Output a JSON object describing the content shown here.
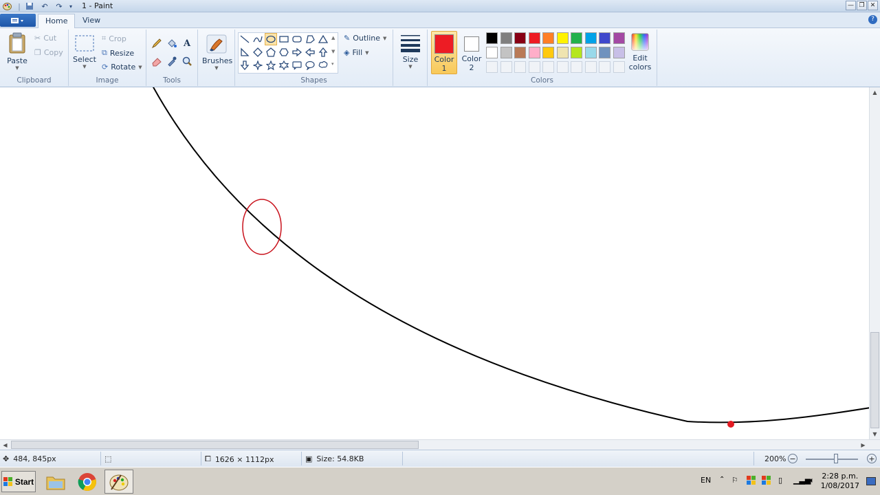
{
  "window": {
    "title": "1 - Paint",
    "controls": [
      "minimize",
      "restore",
      "close"
    ]
  },
  "tabs": [
    {
      "label": "Home",
      "active": true
    },
    {
      "label": "View",
      "active": false
    }
  ],
  "ribbon": {
    "clipboard": {
      "label": "Clipboard",
      "paste": "Paste",
      "cut": "Cut",
      "copy": "Copy"
    },
    "image": {
      "label": "Image",
      "select": "Select",
      "crop": "Crop",
      "resize": "Resize",
      "rotate": "Rotate"
    },
    "tools": {
      "label": "Tools"
    },
    "brushes": {
      "label": "Brushes"
    },
    "shapes": {
      "label": "Shapes",
      "outline": "Outline",
      "fill": "Fill"
    },
    "size": {
      "label": "Size"
    },
    "colors": {
      "label": "Colors",
      "color1_label": "Color",
      "color1_num": "1",
      "color2_label": "Color",
      "color2_num": "2",
      "edit_label": "Edit",
      "edit_label2": "colors",
      "color1": "#ed1c24",
      "color2": "#ffffff",
      "palette_row1": [
        "#000000",
        "#7f7f7f",
        "#880015",
        "#ed1c24",
        "#ff7f27",
        "#fff200",
        "#22b14c",
        "#00a2e8",
        "#3f48cc",
        "#a349a4"
      ],
      "palette_row2": [
        "#ffffff",
        "#c3c3c3",
        "#b97a57",
        "#ffaec9",
        "#ffc90e",
        "#efe4b0",
        "#b5e61d",
        "#99d9ea",
        "#7092be",
        "#c8bfe7"
      ]
    }
  },
  "status": {
    "cursor_pos": "484, 845px",
    "canvas_size": "1626 × 1112px",
    "file_size": "Size: 54.8KB",
    "zoom": "200%"
  },
  "taskbar": {
    "start": "Start",
    "apps": [
      "file-explorer",
      "chrome",
      "paint"
    ],
    "lang": "EN",
    "time": "2:28 p.m.",
    "date": "1/08/2017"
  }
}
